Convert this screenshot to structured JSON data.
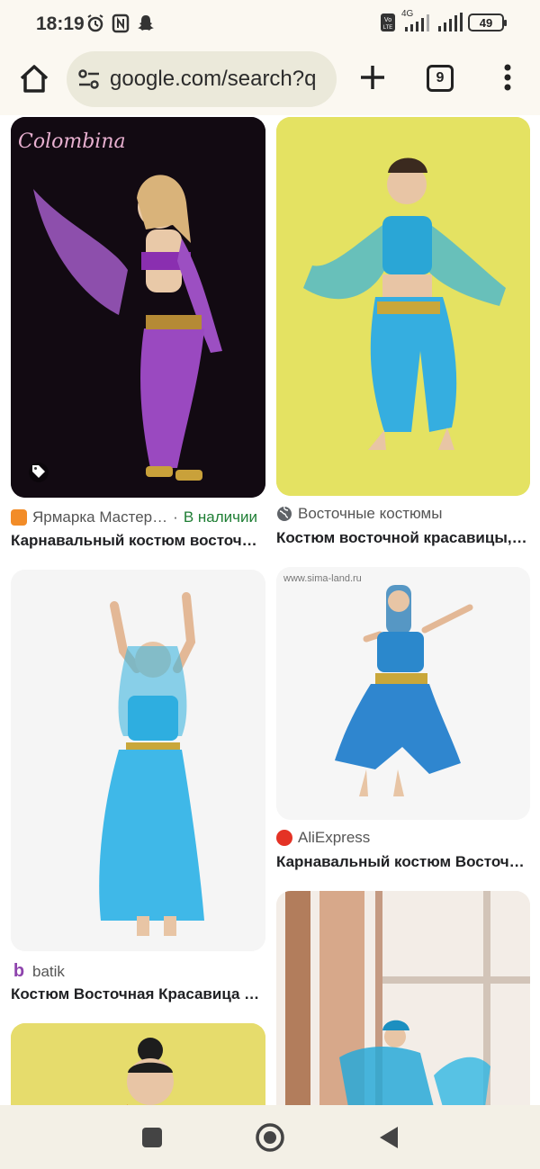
{
  "status_bar": {
    "time": "18:19",
    "network": "4G",
    "battery": "49"
  },
  "toolbar": {
    "url": "google.com/search?q",
    "tab_count": "9"
  },
  "results": [
    {
      "source": "Ярмарка Мастер…",
      "availability": "В наличии",
      "title": "Карнавальный костюм восточ…",
      "watermark": "Colombina"
    },
    {
      "source": "Восточные костюмы",
      "title": "Костюм восточной красавицы,…"
    },
    {
      "source": "batik",
      "title": "Костюм Восточная Красавица …"
    },
    {
      "source": "AliExpress",
      "title": "Карнавальный костюм Восточ…",
      "watermark": "www.sima-land.ru"
    }
  ],
  "colors": {
    "accent_green": "#1e7e34",
    "page_bg": "#fbf8f1",
    "url_bar": "#ebe9da"
  }
}
